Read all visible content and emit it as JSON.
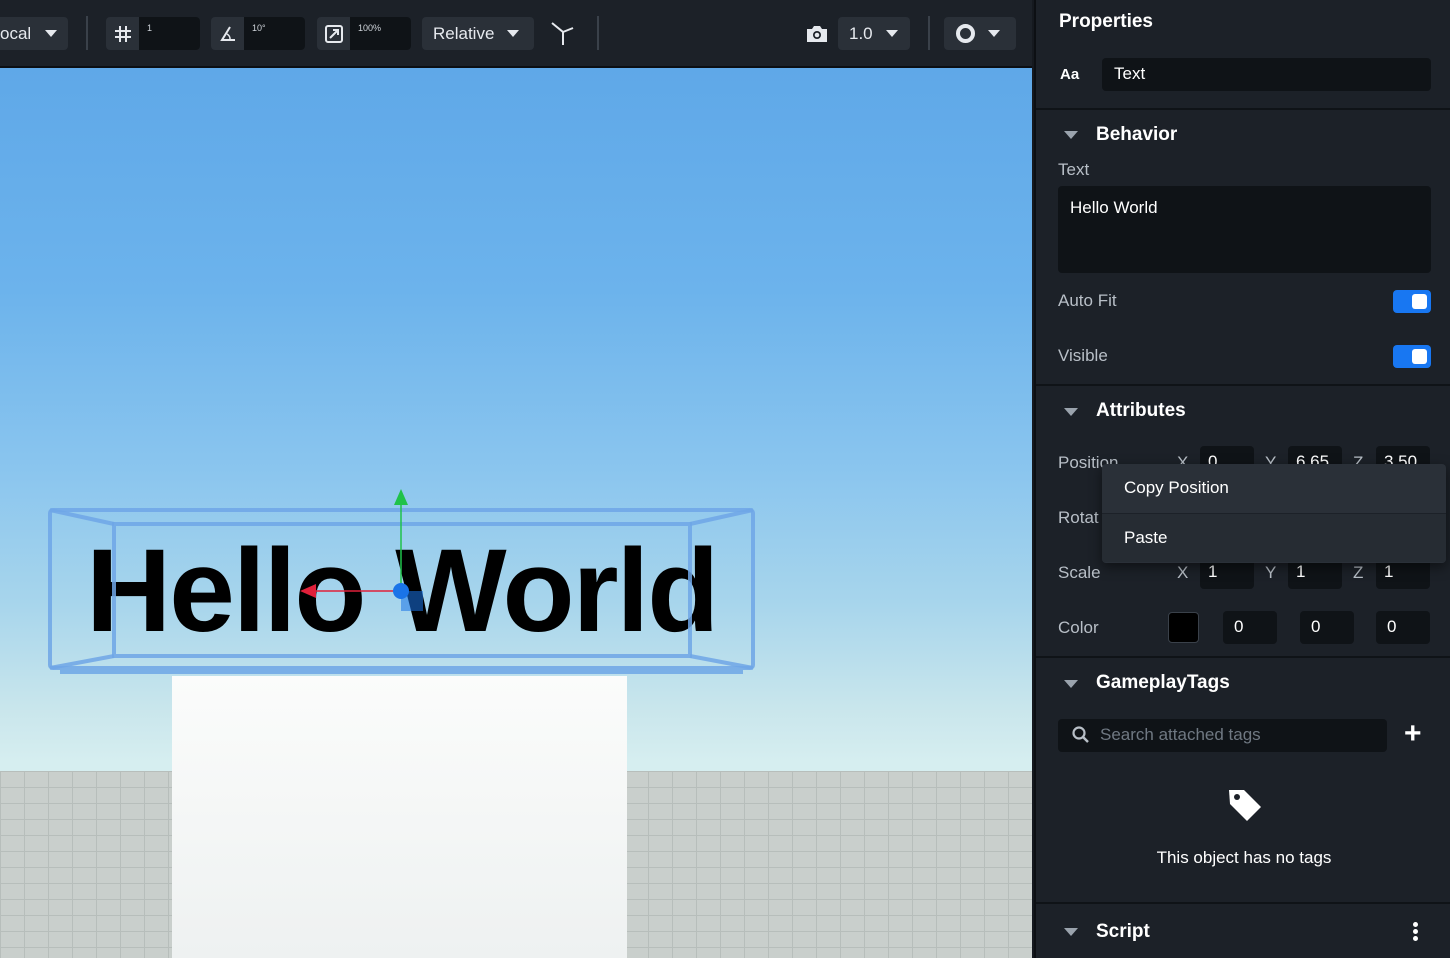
{
  "toolbar": {
    "space_label": "ocal",
    "grid_value": "1",
    "angle_value": "10°",
    "scale_value": "100%",
    "mode_label": "Relative",
    "speed_value": "1.0"
  },
  "viewport": {
    "scene_text": "Hello World"
  },
  "properties": {
    "title": "Properties",
    "type_icon_text": "Aa",
    "object_name": "Text",
    "behavior": {
      "header": "Behavior",
      "text_label": "Text",
      "text_value": "Hello World",
      "auto_fit_label": "Auto Fit",
      "auto_fit_on": true,
      "visible_label": "Visible",
      "visible_on": true
    },
    "attributes": {
      "header": "Attributes",
      "position_label": "Position",
      "position": {
        "x": "0",
        "y": "6.65",
        "z": "3.50"
      },
      "rotation_label": "Rotat",
      "scale_label": "Scale",
      "scale": {
        "x": "1",
        "y": "1",
        "z": "1"
      },
      "color_label": "Color",
      "color": {
        "r": "0",
        "g": "0",
        "b": "0"
      },
      "swatch_color": "#000000",
      "axis_x": "X",
      "axis_y": "Y",
      "axis_z": "Z"
    },
    "gameplay_tags": {
      "header": "GameplayTags",
      "search_placeholder": "Search attached tags",
      "empty_text": "This object has no tags"
    },
    "script": {
      "header": "Script"
    }
  },
  "context_menu": {
    "items": [
      "Copy Position",
      "Paste"
    ]
  },
  "colors": {
    "accent": "#1877f2",
    "panel_bg": "#1c2128",
    "gizmo_x": "#e0203a",
    "gizmo_y": "#1fc24a",
    "gizmo_select": "#1a74e8"
  }
}
